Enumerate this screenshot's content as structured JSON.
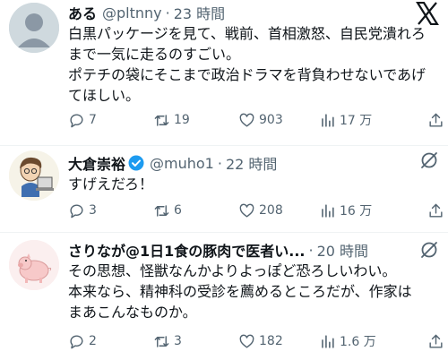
{
  "x_logo": "X",
  "tweets": [
    {
      "name": "ある",
      "handle": "@pltnny",
      "separator": "·",
      "time": "23 時間",
      "verified": false,
      "lines": [
        "白黒パッケージを見て、戦前、首相激怒、自民党潰れろ",
        "まで一気に走るのすごい。",
        "ポテチの袋にそこまで政治ドラマを背負わせないであげ",
        "てほしい。"
      ],
      "replies": "7",
      "retweets": "19",
      "likes": "903",
      "views": "17 万"
    },
    {
      "name": "大倉崇裕",
      "handle": "@muho1",
      "separator": "·",
      "time": "22 時間",
      "verified": true,
      "lines": [
        "すげえだろ！"
      ],
      "replies": "3",
      "retweets": "6",
      "likes": "208",
      "views": "16 万"
    },
    {
      "name": "さりなが@1日1食の豚肉で医者い...",
      "handle": "",
      "separator": "·",
      "time": "20 時間",
      "verified": false,
      "lines": [
        "その思想、怪獣なんかよりよっぽど恐ろしいわい。",
        "本来なら、精神科の受診を薦めるところだが、作家は",
        "まあこんなものか。"
      ],
      "replies": "2",
      "retweets": "3",
      "likes": "182",
      "views": "1.6 万"
    }
  ],
  "colors": {
    "text": "#0f1419",
    "secondary": "#536471",
    "verified": "#1d9bf0",
    "divider": "#eff3f4"
  }
}
